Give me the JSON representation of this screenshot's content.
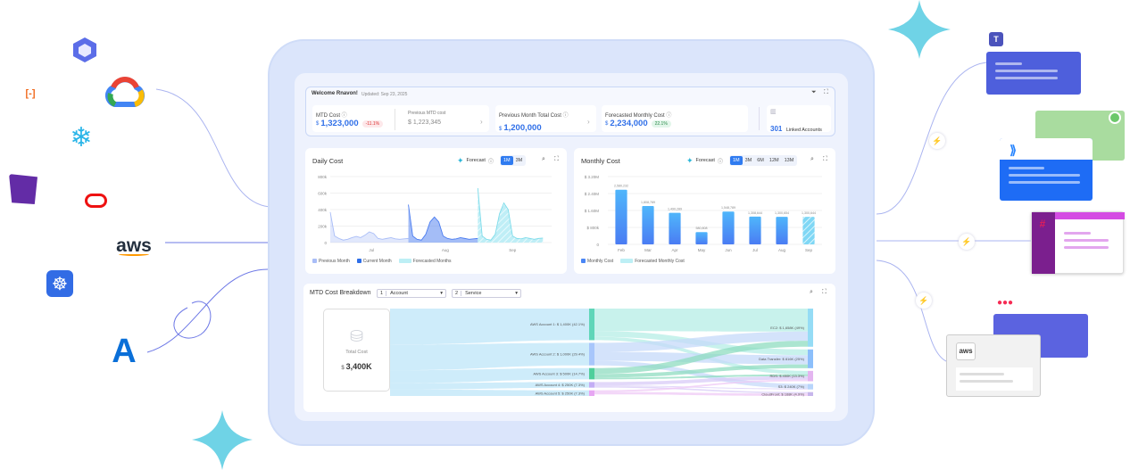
{
  "colors": {
    "accent": "#2f7bf0",
    "frame": "#dbe5fb",
    "star": "#6fd3e6"
  },
  "logos": [
    {
      "name": "microsoft-copilot",
      "text": ""
    },
    {
      "name": "alibaba-cloud",
      "text": "[-]"
    },
    {
      "name": "google-cloud",
      "text": ""
    },
    {
      "name": "snowflake",
      "text": "❄"
    },
    {
      "name": "datadog",
      "text": ""
    },
    {
      "name": "oracle",
      "text": ""
    },
    {
      "name": "aws",
      "text": "aws"
    },
    {
      "name": "kubernetes",
      "text": "☸"
    },
    {
      "name": "azure",
      "text": "A"
    }
  ],
  "integrations": [
    {
      "name": "microsoft-teams"
    },
    {
      "name": "jira"
    },
    {
      "name": "slack"
    },
    {
      "name": "monday"
    },
    {
      "name": "aws"
    }
  ],
  "header": {
    "welcome": "Welcome Rnavon!",
    "updated": "Updated: Sep 23, 2025"
  },
  "kpis": {
    "mtd": {
      "label": "MTD Cost",
      "currency": "$",
      "value": "1,323,000",
      "change": "-11.1%",
      "prev_label": "Previous MTD cost",
      "prev_value": "1,223,345"
    },
    "prev_month": {
      "label": "Previous Month Total Cost",
      "currency": "$",
      "value": "1,200,000"
    },
    "forecast": {
      "label": "Forecasted Monthly Cost",
      "currency": "$",
      "value": "2,234,000",
      "change": "22.1%"
    },
    "linked": {
      "count": "301",
      "label": "Linked Accounts"
    }
  },
  "daily": {
    "title": "Daily Cost",
    "forecast_label": "Forecast",
    "ranges": [
      "1M",
      "3M"
    ],
    "selected": "1M"
  },
  "monthly": {
    "title": "Monthly Cost",
    "forecast_label": "Forecast",
    "ranges": [
      "1M",
      "3M",
      "6M",
      "12M",
      "13M"
    ],
    "selected": "1M"
  },
  "breakdown": {
    "title": "MTD Cost Breakdown",
    "group1_index": "1",
    "group1": "Account",
    "group2_index": "2",
    "group2": "Service",
    "total_label": "Total Cost",
    "total_currency": "$",
    "total_value": "3,400K"
  },
  "chart_data": [
    {
      "type": "area",
      "title": "Daily Cost",
      "ylim": [
        0,
        800000
      ],
      "yticks": [
        "0",
        "200k",
        "400k",
        "600k",
        "800k"
      ],
      "xticks": [
        "Jul",
        "Aug",
        "Sep"
      ],
      "series": [
        {
          "name": "Previous Month",
          "month": "Jul",
          "color": "#a9bdf7",
          "values": [
            370000,
            80000,
            50000,
            30000,
            40000,
            60000,
            75000,
            60000,
            90000,
            130000,
            110000,
            50000,
            40000,
            50000,
            60000,
            45000,
            40000,
            45000,
            50000
          ]
        },
        {
          "name": "Current Month",
          "month": "Aug",
          "color": "#4a7cf0",
          "values": [
            460000,
            80000,
            40000,
            30000,
            100000,
            250000,
            310000,
            250000,
            80000,
            50000,
            40000,
            45000,
            60000,
            50000,
            40000,
            45000,
            50000
          ]
        },
        {
          "name": "Forecasted Months",
          "month": "Sep",
          "color": "#7fdcea",
          "values": [
            660000,
            80000,
            40000,
            30000,
            100000,
            350000,
            480000,
            400000,
            80000,
            50000,
            45000,
            60000,
            50000,
            40000,
            50000,
            55000
          ]
        }
      ]
    },
    {
      "type": "bar",
      "title": "Monthly Cost",
      "ylim": [
        0,
        3200000
      ],
      "yticks": [
        "0",
        "$ 800k",
        "$ 1.60M",
        "$ 2.40M",
        "$ 3.20M"
      ],
      "categories": [
        "Feb",
        "Mar",
        "Apr",
        "May",
        "Jun",
        "Jul",
        "Aug",
        "Sep"
      ],
      "values": [
        2580232,
        1808789,
        1490289,
        580808,
        1548789,
        1308644,
        1300654,
        1300644
      ],
      "labels": [
        "2,580,232",
        "1,808,789",
        "1,490,289",
        "580,808",
        "1,548,789",
        "1,308,644",
        "1,300,654",
        "1,300,644"
      ],
      "forecast": [
        false,
        false,
        false,
        false,
        false,
        false,
        false,
        true
      ],
      "legend": [
        "Monthly Cost",
        "Forecasted Monthly Cost"
      ]
    },
    {
      "type": "sankey",
      "title": "MTD Cost Breakdown",
      "accounts": [
        {
          "label": "AWS Account 1: $ 1,400K (42.1%)",
          "value": 1400,
          "color": "#5fd6b8",
          "flow": "#b6ede6"
        },
        {
          "label": "AWS Account 2: $ 1,000K (29.4%)",
          "value": 1000,
          "color": "#a8c6fb",
          "flow": "#c5daf9"
        },
        {
          "label": "AWS Account 3: $ 500K (14.7%)",
          "value": 500,
          "color": "#4fcf9b",
          "flow": "#8fdcc0"
        },
        {
          "label": "AWS Account 4: $ 250K (7.3%)",
          "value": 250,
          "color": "#c3adf5",
          "flow": "#d8cbf7"
        },
        {
          "label": "AWS Account 5: $ 250K (7.3%)",
          "value": 250,
          "color": "#e7a6f3",
          "flow": "#efc9f6"
        }
      ],
      "services": [
        {
          "label": "EC2: $ 1,658K (49%)",
          "value": 1658,
          "color": "#95dcf5"
        },
        {
          "label": "Data Transfer: $ 816K (25%)",
          "value": 816,
          "color": "#8cbffb"
        },
        {
          "label": "RDS: $ 450K (13.3%)",
          "value": 450,
          "color": "#e4b5f0"
        },
        {
          "label": "S3: $ 240K (7%)",
          "value": 240,
          "color": "#b8d5fb"
        },
        {
          "label": "CloudFront: $ 168K (4.9%)",
          "value": 168,
          "color": "#c7b6ec"
        }
      ],
      "links": [
        [
          0,
          0,
          1000
        ],
        [
          0,
          1,
          250
        ],
        [
          0,
          2,
          150
        ],
        [
          1,
          0,
          400
        ],
        [
          1,
          1,
          400
        ],
        [
          1,
          3,
          200
        ],
        [
          2,
          0,
          258
        ],
        [
          2,
          1,
          166
        ],
        [
          2,
          2,
          76
        ],
        [
          3,
          2,
          150
        ],
        [
          3,
          3,
          40
        ],
        [
          3,
          4,
          60
        ],
        [
          4,
          2,
          74
        ],
        [
          4,
          4,
          108
        ]
      ]
    }
  ]
}
